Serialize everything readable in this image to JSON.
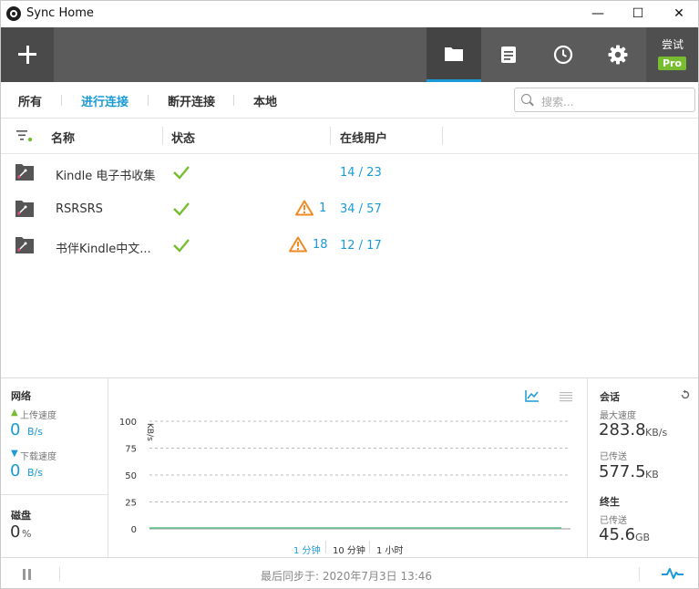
{
  "window": {
    "title": "Sync Home",
    "minimize_glyph": "—",
    "maximize_glyph": "☐",
    "close_glyph": "✕"
  },
  "toolbar": {
    "add_icon": "plus-icon",
    "tabs": [
      {
        "icon": "folder-icon",
        "active": true
      },
      {
        "icon": "document-icon",
        "active": false
      },
      {
        "icon": "clock-icon",
        "active": false
      },
      {
        "icon": "gear-icon",
        "active": false
      }
    ],
    "trial_label": "尝试",
    "pro_badge": "Pro",
    "accent_color": "#1a9bd7",
    "pro_color": "#77bd2f"
  },
  "filters": {
    "tabs": [
      "所有",
      "进行连接",
      "断开连接",
      "本地"
    ],
    "active_index": 1,
    "search_placeholder": "搜索..."
  },
  "list": {
    "columns": [
      "名称",
      "状态",
      "在线用户"
    ],
    "rows": [
      {
        "name": "Kindle 电子书收集",
        "status": "ok",
        "warning_count": "",
        "users": "14 / 23"
      },
      {
        "name": "RSRSRS",
        "status": "ok",
        "warning_count": "1",
        "users": "34 / 57"
      },
      {
        "name": "书伴Kindle中文...",
        "status": "ok",
        "warning_count": "18",
        "users": "12 / 17"
      }
    ]
  },
  "network": {
    "title": "网络",
    "upload_label": "上传速度",
    "upload_value": "0",
    "upload_unit": "B/s",
    "download_label": "下载速度",
    "download_value": "0",
    "download_unit": "B/s"
  },
  "disk": {
    "title": "磁盘",
    "value": "0",
    "unit": "%"
  },
  "chart_data": {
    "type": "area",
    "ylabel": "KB/s",
    "yticks": [
      "100",
      "75",
      "50",
      "25",
      "0"
    ],
    "ylim": [
      0,
      100
    ],
    "series": [
      {
        "values": [
          0,
          0,
          0,
          0,
          0,
          0,
          0,
          0,
          0,
          0
        ]
      }
    ],
    "grid": true,
    "time_buttons": [
      "1 分钟",
      "10 分钟",
      "1 小时"
    ],
    "active_time_index": 0
  },
  "session": {
    "title": "会话",
    "max_speed_label": "最大速度",
    "max_speed_value": "283.8",
    "max_speed_unit": "KB/s",
    "transferred_label": "已传送",
    "transferred_value": "577.5",
    "transferred_unit": "KB"
  },
  "lifetime": {
    "title": "终生",
    "transferred_label": "已传送",
    "transferred_value": "45.6",
    "transferred_unit": "GB"
  },
  "statusbar": {
    "last_sync": "最后同步于:  2020年7月3日 13:46"
  }
}
